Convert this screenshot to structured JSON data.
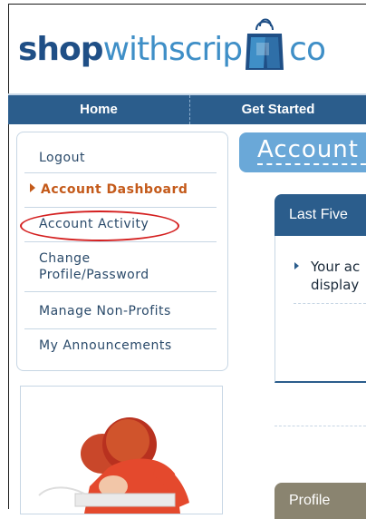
{
  "logo": {
    "bold": "shop",
    "light": "withscrip",
    "tail": "co"
  },
  "nav": {
    "home": "Home",
    "get_started": "Get Started"
  },
  "sidebar": {
    "items": [
      {
        "label": "Logout"
      },
      {
        "label": "Account Dashboard",
        "active": true
      },
      {
        "label": "Account Activity",
        "highlighted": true
      },
      {
        "label_line1": "Change",
        "label_line2": "Profile/Password"
      },
      {
        "label": "Manage Non-Profits"
      },
      {
        "label": "My Announcements"
      }
    ]
  },
  "main": {
    "title": "Account",
    "panel_title": "Last Five",
    "panel_text_line1": "Your ac",
    "panel_text_line2": "display",
    "profile_title": "Profile"
  },
  "colors": {
    "nav": "#2b5d8c",
    "title_bg": "#6aa8d8",
    "active": "#c45a1a",
    "annotation": "#d42020"
  }
}
